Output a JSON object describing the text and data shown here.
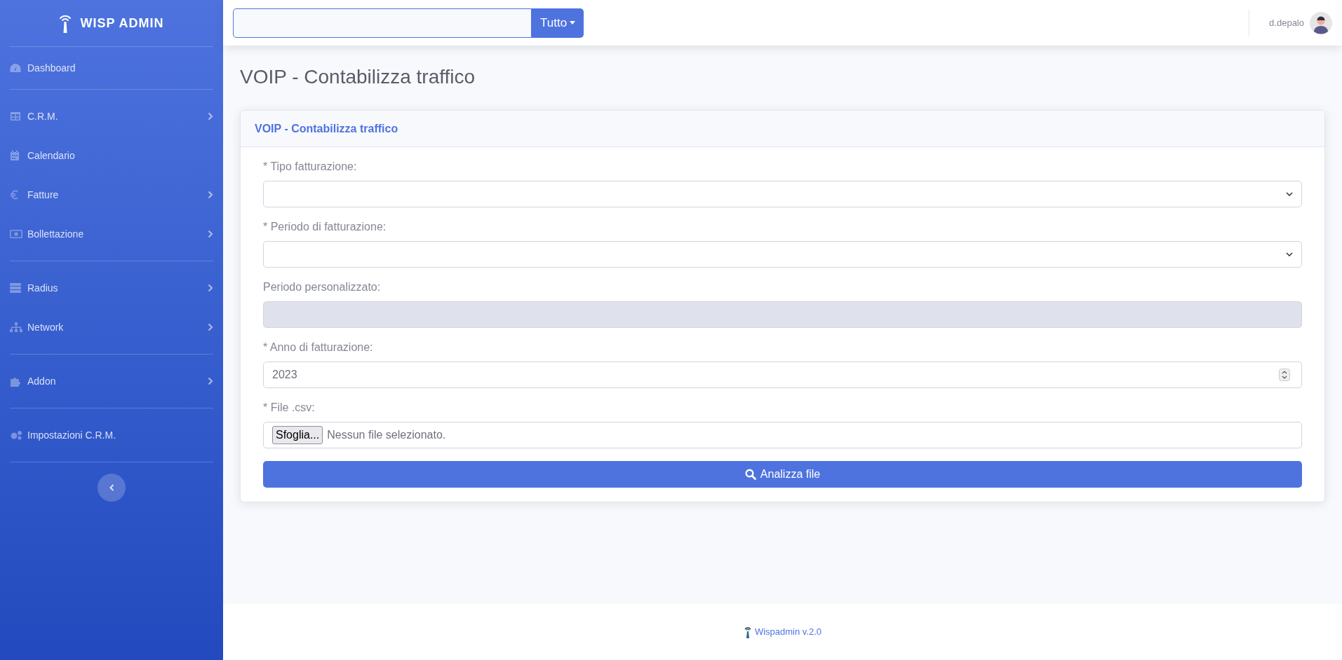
{
  "sidebar": {
    "brand": "WISP ADMIN",
    "sections": [
      [
        {
          "label": "Dashboard",
          "has_submenu": false
        }
      ],
      [
        {
          "label": "C.R.M.",
          "has_submenu": true
        },
        {
          "label": "Calendario",
          "has_submenu": false
        },
        {
          "label": "Fatture",
          "has_submenu": true
        },
        {
          "label": "Bollettazione",
          "has_submenu": true
        }
      ],
      [
        {
          "label": "Radius",
          "has_submenu": true
        },
        {
          "label": "Network",
          "has_submenu": true
        }
      ],
      [
        {
          "label": "Addon",
          "has_submenu": true
        }
      ],
      [
        {
          "label": "Impostazioni C.R.M.",
          "has_submenu": false
        }
      ]
    ]
  },
  "topbar": {
    "search_scope": "Tutto",
    "user": "d.depalo"
  },
  "page_title": "VOIP - Contabilizza traffico",
  "card": {
    "title": "VOIP - Contabilizza traffico",
    "fields": [
      {
        "label": "* Tipo fatturazione:",
        "kind": "select",
        "disabled": false
      },
      {
        "label": "* Periodo di fatturazione:",
        "kind": "select",
        "disabled": false
      },
      {
        "label": "Periodo personalizzato:",
        "kind": "text",
        "disabled": true
      },
      {
        "label": "* Anno di fatturazione:",
        "kind": "number",
        "value": "2023",
        "disabled": false
      },
      {
        "label": "* File .csv:",
        "kind": "file",
        "button": "Sfoglia...",
        "value": "Nessun file selezionato.",
        "disabled": false
      }
    ],
    "submit": "Analizza file"
  },
  "footer": "Wispadmin v.2.0"
}
